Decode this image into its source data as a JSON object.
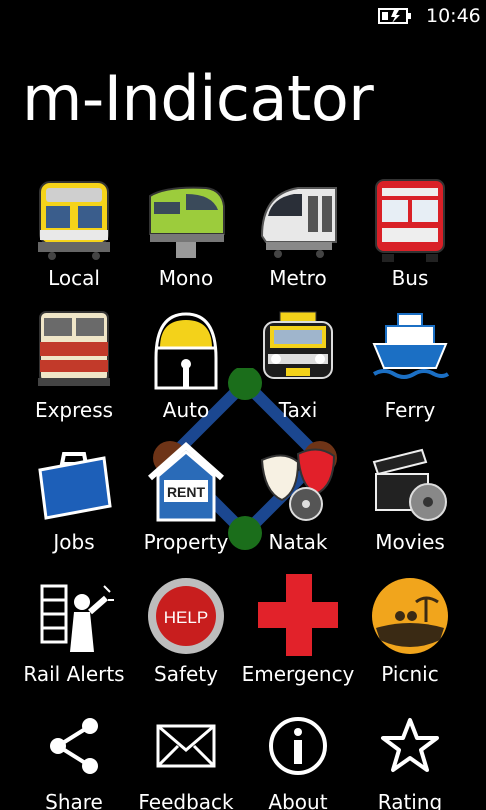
{
  "status": {
    "time": "10:46",
    "battery_icon": "battery-charging-icon"
  },
  "app": {
    "title": "m-Indicator"
  },
  "tiles": [
    {
      "label": "Local",
      "icon": "local-train-icon"
    },
    {
      "label": "Mono",
      "icon": "monorail-icon"
    },
    {
      "label": "Metro",
      "icon": "metro-train-icon"
    },
    {
      "label": "Bus",
      "icon": "bus-icon"
    },
    {
      "label": "Express",
      "icon": "express-train-icon"
    },
    {
      "label": "Auto",
      "icon": "auto-rickshaw-icon"
    },
    {
      "label": "Taxi",
      "icon": "taxi-icon"
    },
    {
      "label": "Ferry",
      "icon": "ferry-icon"
    },
    {
      "label": "Jobs",
      "icon": "briefcase-icon"
    },
    {
      "label": "Property",
      "icon": "rent-house-icon"
    },
    {
      "label": "Natak",
      "icon": "theatre-masks-icon"
    },
    {
      "label": "Movies",
      "icon": "film-clapper-icon"
    },
    {
      "label": "Rail Alerts",
      "icon": "rail-alerts-icon"
    },
    {
      "label": "Safety",
      "icon": "help-button-icon"
    },
    {
      "label": "Emergency",
      "icon": "red-cross-icon"
    },
    {
      "label": "Picnic",
      "icon": "picnic-icon"
    }
  ],
  "bottom_bar": [
    {
      "label": "Share",
      "icon": "share-icon"
    },
    {
      "label": "Feedback",
      "icon": "envelope-icon"
    },
    {
      "label": "About",
      "icon": "info-icon"
    },
    {
      "label": "Rating",
      "icon": "star-icon"
    }
  ],
  "colors": {
    "background": "#000000",
    "text": "#ffffff",
    "bus_red": "#d92027",
    "cross_red": "#e2222a",
    "help_red": "#c81e1e",
    "ferry_blue": "#1b6fc4",
    "briefcase_blue": "#1d5fb8"
  }
}
